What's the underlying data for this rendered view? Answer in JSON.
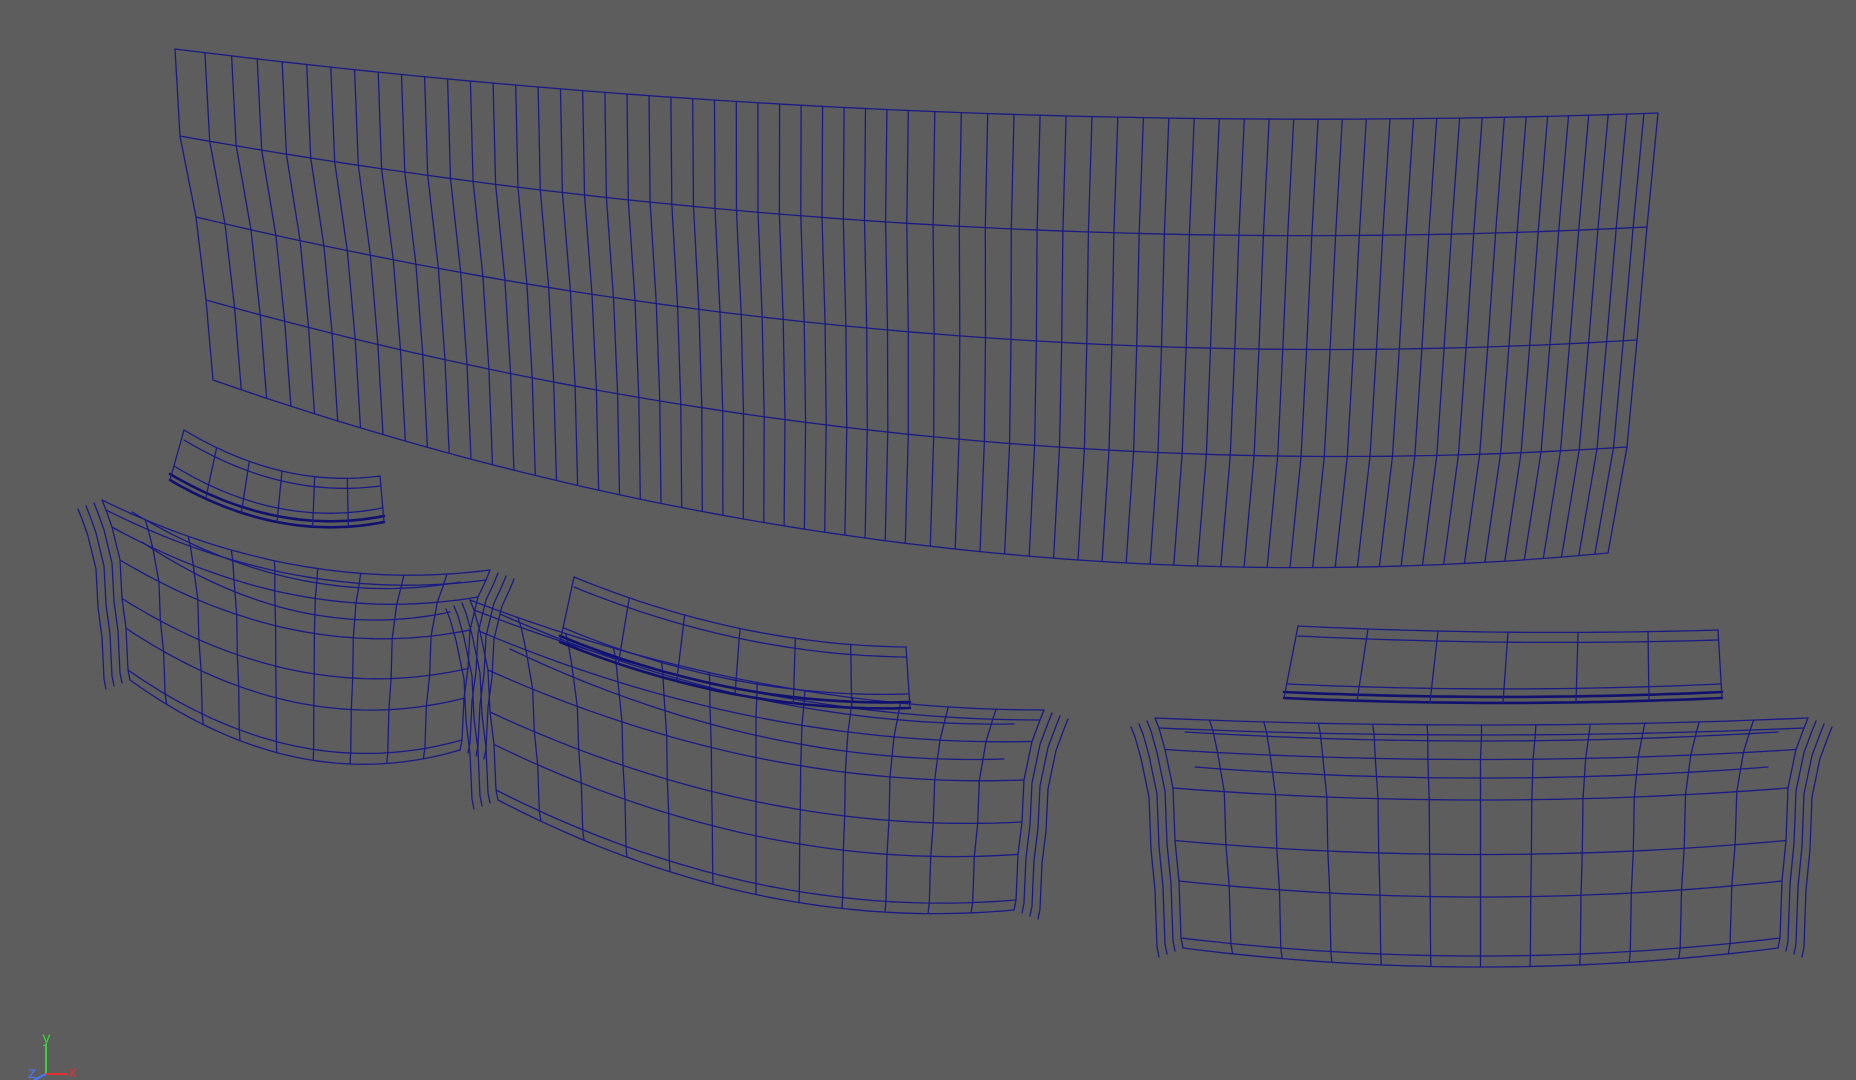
{
  "viewport": {
    "background_color": "#5d5d5d",
    "wireframe_color": "#1a1a86",
    "display_mode": "wireframe"
  },
  "objects": [
    {
      "name": "curved-wall-panel",
      "kind": "grid-mesh",
      "columns": 64,
      "rows": 5
    },
    {
      "name": "seating-module-left",
      "kind": "curved-bench-counter"
    },
    {
      "name": "seating-module-center",
      "kind": "curved-bench-counter"
    },
    {
      "name": "seating-module-right",
      "kind": "curved-bench-counter"
    }
  ],
  "axis_gizmo": {
    "y": {
      "label": "y",
      "color": "#3ad03a"
    },
    "x": {
      "label": "x",
      "color": "#e03030"
    },
    "z": {
      "label": "z",
      "color": "#4a78ff"
    }
  }
}
